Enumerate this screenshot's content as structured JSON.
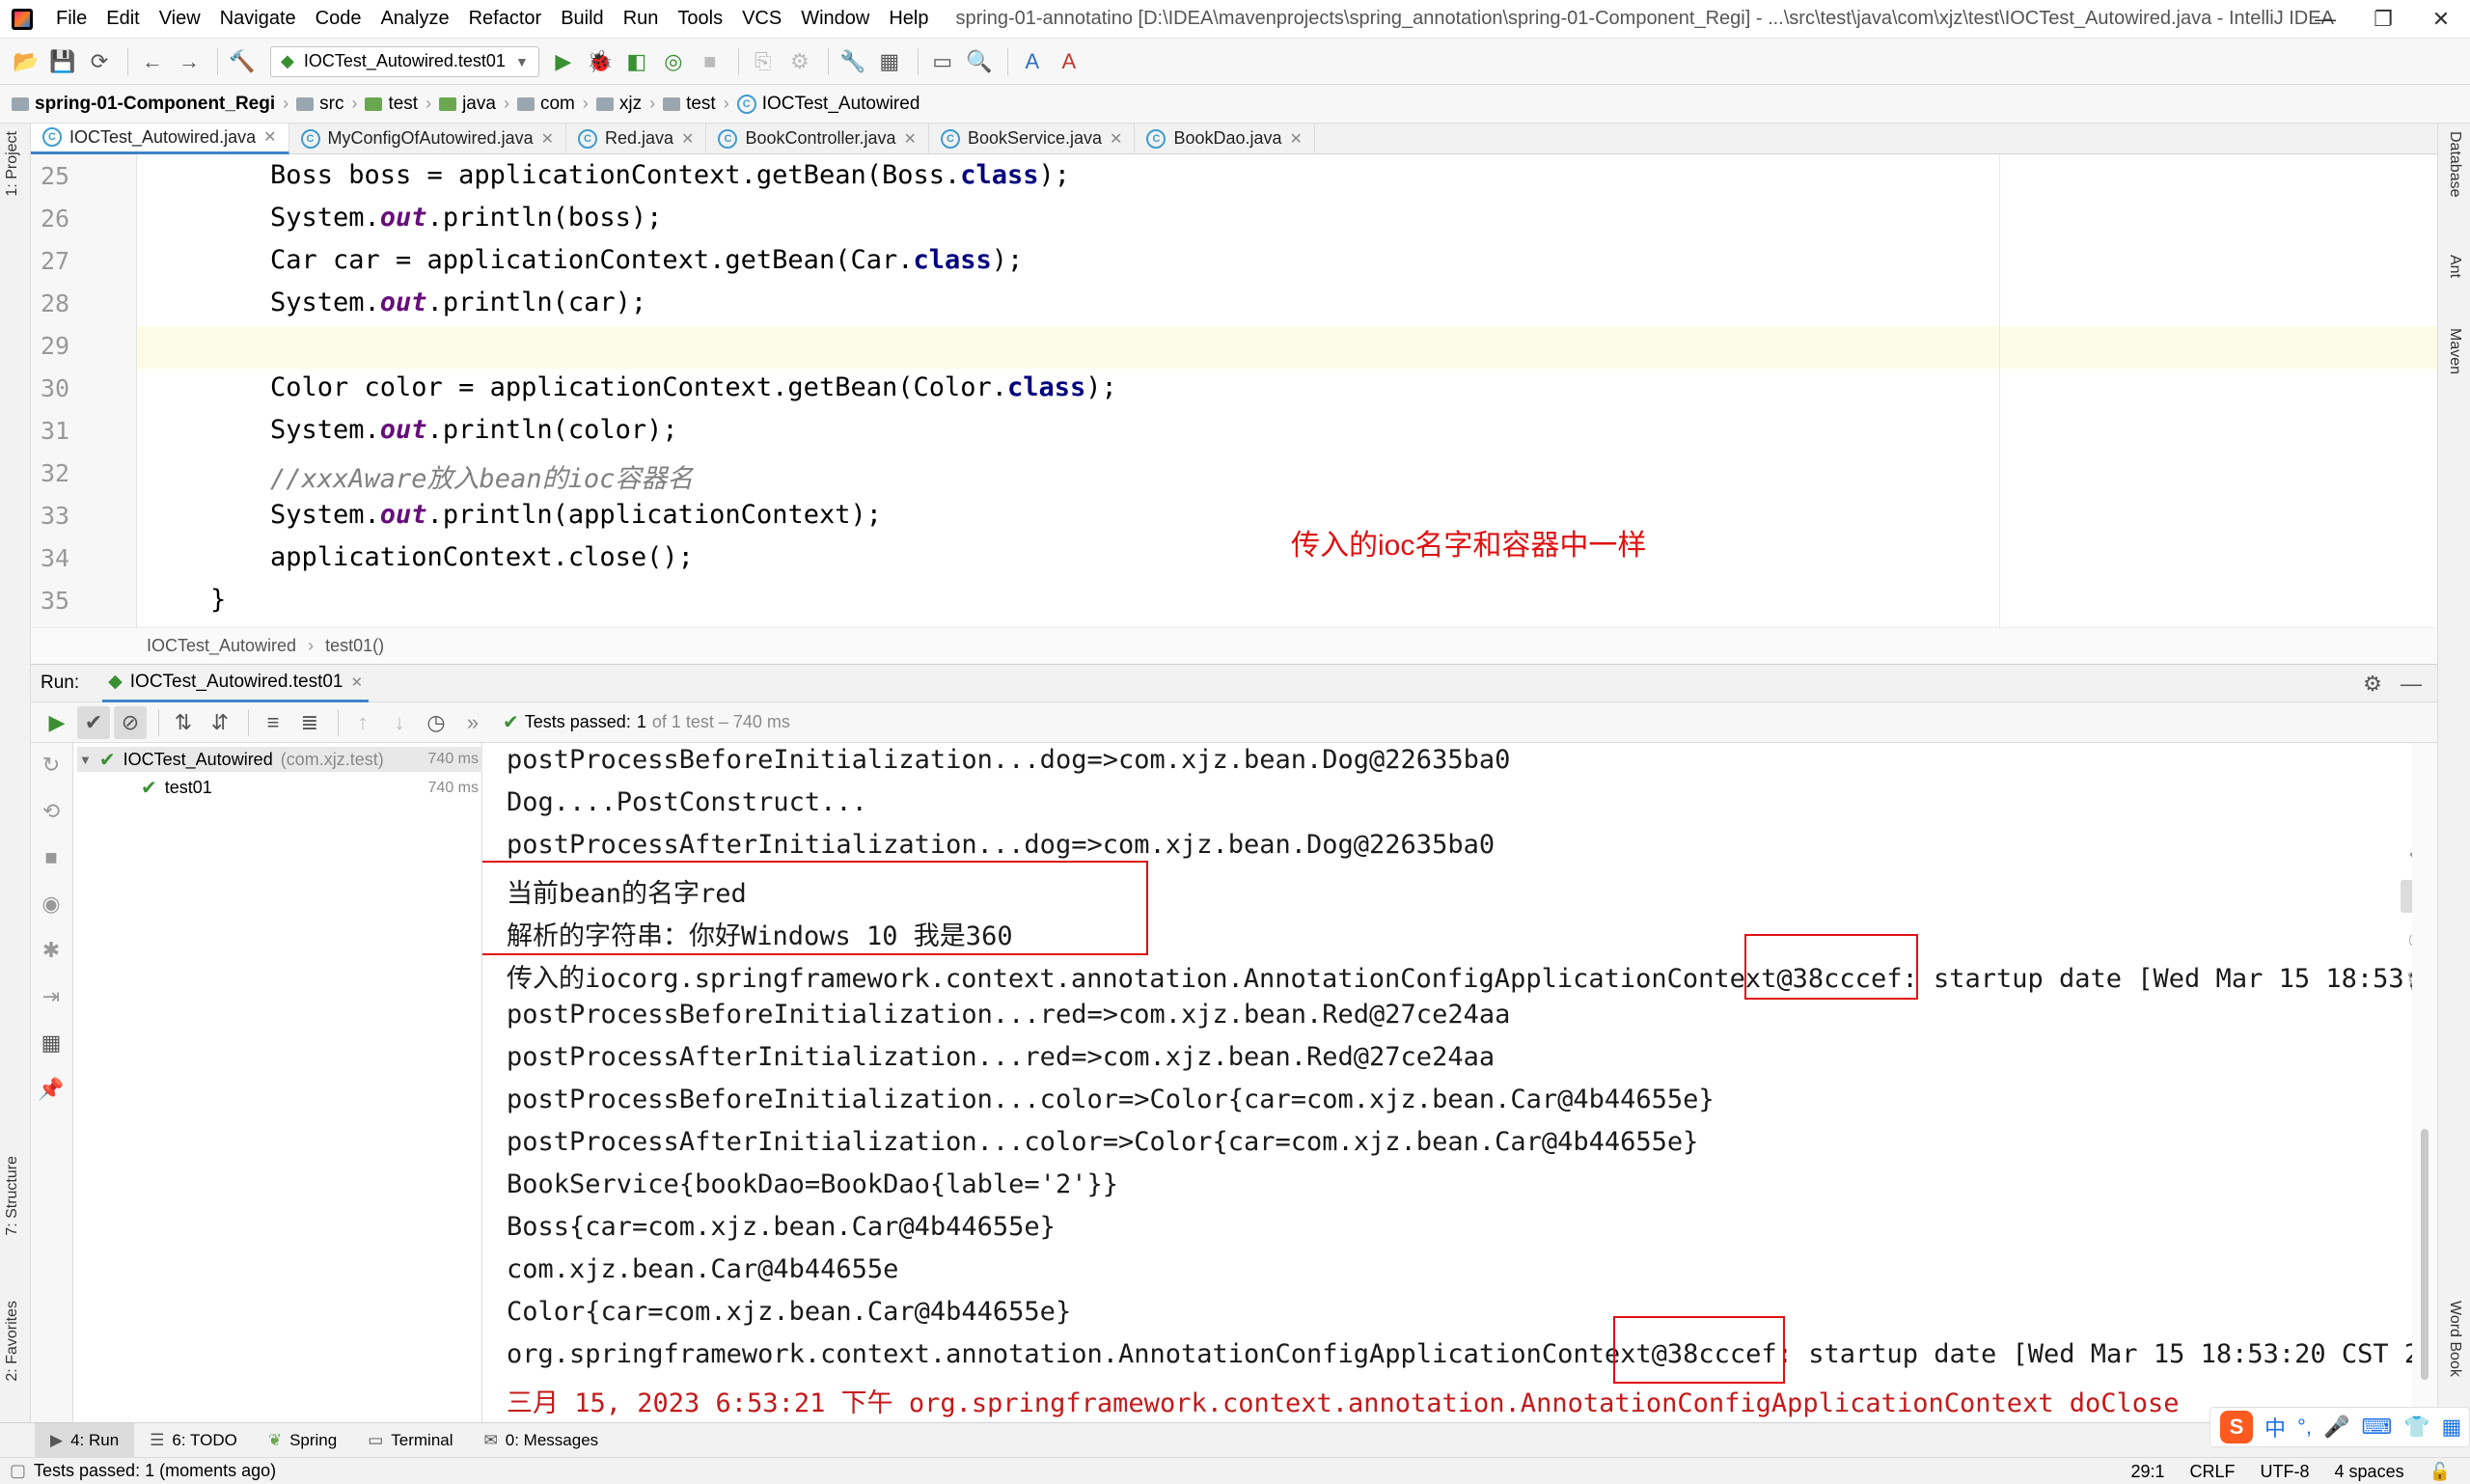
{
  "menubar": {
    "items": [
      "File",
      "Edit",
      "View",
      "Navigate",
      "Code",
      "Analyze",
      "Refactor",
      "Build",
      "Run",
      "Tools",
      "VCS",
      "Window",
      "Help"
    ],
    "title": "spring-01-annotatino [D:\\IDEA\\mavenprojects\\spring_annotation\\spring-01-Component_Regi] - ...\\src\\test\\java\\com\\xjz\\test\\IOCTest_Autowired.java - IntelliJ IDEA",
    "window_controls": [
      "—",
      "❐",
      "✕"
    ]
  },
  "toolbar": {
    "run_config": "IOCTest_Autowired.test01"
  },
  "breadcrumb": [
    "spring-01-Component_Regi",
    "src",
    "test",
    "java",
    "com",
    "xjz",
    "test",
    "IOCTest_Autowired"
  ],
  "tabs": [
    {
      "label": "IOCTest_Autowired.java",
      "active": true
    },
    {
      "label": "MyConfigOfAutowired.java",
      "active": false
    },
    {
      "label": "Red.java",
      "active": false
    },
    {
      "label": "BookController.java",
      "active": false
    },
    {
      "label": "BookService.java",
      "active": false
    },
    {
      "label": "BookDao.java",
      "active": false
    }
  ],
  "editor": {
    "line_numbers": [
      "25",
      "26",
      "27",
      "28",
      "29",
      "30",
      "31",
      "32",
      "33",
      "34",
      "35"
    ],
    "annotation": "传入的ioc名字和容器中一样",
    "breadcrumb_class": "IOCTest_Autowired",
    "breadcrumb_method": "test01()"
  },
  "left_tools": {
    "project": "1: Project",
    "structure": "7: Structure",
    "favorites": "2: Favorites"
  },
  "right_tools": {
    "database": "Database",
    "ant": "Ant",
    "maven": "Maven",
    "wordbook": "Word Book"
  },
  "run": {
    "label": "Run:",
    "tab": "IOCTest_Autowired.test01",
    "status_prefix": "Tests passed:",
    "status_count": "1",
    "status_suffix": "of 1 test – 740 ms",
    "tree": [
      {
        "name": "IOCTest_Autowired",
        "pkg": "(com.xjz.test)",
        "time": "740 ms"
      },
      {
        "name": "test01",
        "pkg": "",
        "time": "740 ms"
      }
    ]
  },
  "console": [
    "postProcessBeforeInitialization...dog=>com.xjz.bean.Dog@22635ba0",
    "Dog....PostConstruct...",
    "postProcessAfterInitialization...dog=>com.xjz.bean.Dog@22635ba0",
    "当前bean的名字red",
    "解析的字符串：你好Windows 10 我是360",
    "传入的iocorg.springframework.context.annotation.AnnotationConfigApplicationContext@38cccef: startup date [Wed Mar 15 18:53:",
    "postProcessBeforeInitialization...red=>com.xjz.bean.Red@27ce24aa",
    "postProcessAfterInitialization...red=>com.xjz.bean.Red@27ce24aa",
    "postProcessBeforeInitialization...color=>Color{car=com.xjz.bean.Car@4b44655e}",
    "postProcessAfterInitialization...color=>Color{car=com.xjz.bean.Car@4b44655e}",
    "BookService{bookDao=BookDao{lable='2'}}",
    "Boss{car=com.xjz.bean.Car@4b44655e}",
    "com.xjz.bean.Car@4b44655e",
    "Color{car=com.xjz.bean.Car@4b44655e}",
    "org.springframework.context.annotation.AnnotationConfigApplicationContext@38cccef: startup date [Wed Mar 15 18:53:20 CST 20",
    "三月 15, 2023 6:53:21 下午 org.springframework.context.annotation.AnnotationConfigApplicationContext doClose"
  ],
  "tool_tabs": [
    "4: Run",
    "6: TODO",
    "Spring",
    "Terminal",
    "0: Messages"
  ],
  "statusbar": {
    "message": "Tests passed: 1 (moments ago)",
    "position": "29:1",
    "line_sep": "CRLF",
    "encoding": "UTF-8",
    "indent": "4 spaces"
  },
  "ime": {
    "logo": "S",
    "label": "中"
  },
  "colors": {
    "keyword": "#000080",
    "field": "#660e7a",
    "comment": "#808080",
    "annotation": "#e01010",
    "pass": "#3a8f33"
  }
}
